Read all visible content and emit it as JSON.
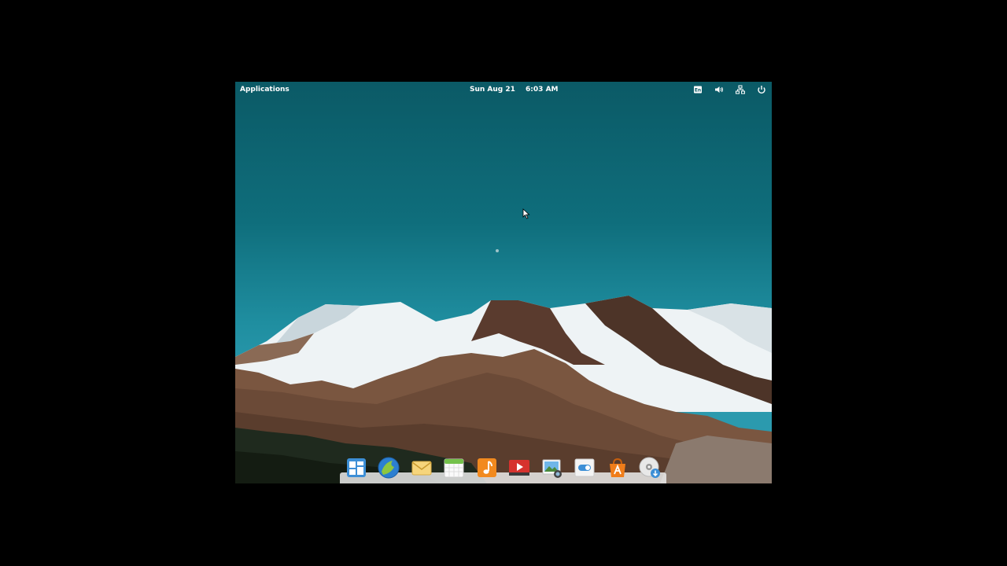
{
  "panel": {
    "applications_label": "Applications",
    "date": "Sun Aug 21",
    "time": "6:03 AM",
    "indicators": [
      "keyboard-icon",
      "volume-icon",
      "network-icon",
      "power-icon"
    ]
  },
  "dock": {
    "apps": [
      {
        "name": "multitasking-view-icon"
      },
      {
        "name": "web-browser-icon"
      },
      {
        "name": "mail-icon"
      },
      {
        "name": "calendar-icon"
      },
      {
        "name": "music-icon"
      },
      {
        "name": "videos-icon"
      },
      {
        "name": "photos-icon"
      },
      {
        "name": "switchboard-settings-icon"
      },
      {
        "name": "appcenter-icon"
      },
      {
        "name": "installer-icon"
      }
    ]
  },
  "colors": {
    "sky_top": "#0b5a66",
    "sky_bottom": "#2b9aae",
    "snow": "#eef3f5",
    "rock": "#6b4a37"
  }
}
